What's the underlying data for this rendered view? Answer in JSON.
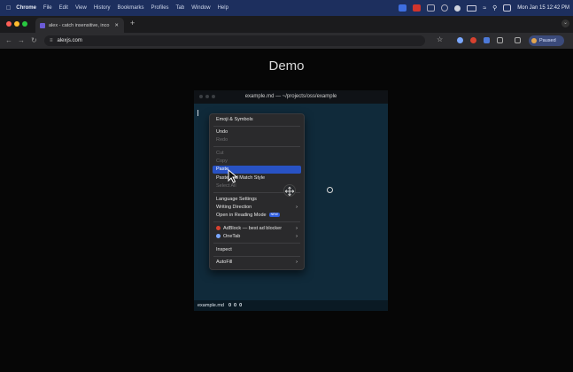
{
  "menubar": {
    "app": "Chrome",
    "items": [
      "File",
      "Edit",
      "View",
      "History",
      "Bookmarks",
      "Profiles",
      "Tab",
      "Window",
      "Help"
    ],
    "clock": "Mon Jan 15  12:42 PM"
  },
  "browser": {
    "tab_title": "alex - catch insensitive, inco",
    "url": "alexjs.com",
    "profile_label": "Paused"
  },
  "page": {
    "title": "Demo"
  },
  "editor": {
    "title": "example.md — ~/projects/oss/example",
    "status_filename": "example.md",
    "counts": [
      "0",
      "0",
      "0"
    ]
  },
  "context_menu": {
    "items": [
      {
        "label": "Emoji & Symbols",
        "disabled": false
      },
      {
        "label": "Undo",
        "disabled": false
      },
      {
        "label": "Redo",
        "disabled": true
      },
      {
        "label": "Cut",
        "disabled": true
      },
      {
        "label": "Copy",
        "disabled": true
      },
      {
        "label": "Paste",
        "disabled": false,
        "highlighted": true
      },
      {
        "label": "Paste and Match Style",
        "disabled": false
      },
      {
        "label": "Select All",
        "disabled": true
      },
      {
        "label": "Language Settings",
        "disabled": false
      },
      {
        "label": "Writing Direction",
        "disabled": false,
        "submenu": true
      },
      {
        "label": "Open in Reading Mode",
        "disabled": false,
        "badge": "NEW"
      },
      {
        "label": "AdBlock — best ad blocker",
        "disabled": false,
        "submenu": true
      },
      {
        "label": "OneTab",
        "disabled": false,
        "submenu": true
      },
      {
        "label": "Inspect",
        "disabled": false
      },
      {
        "label": "AutoFill",
        "disabled": false,
        "submenu": true
      }
    ]
  },
  "colors": {
    "menubar": "#1d2f5e",
    "editor_bg": "#102a3a",
    "highlight": "#2852c4"
  }
}
